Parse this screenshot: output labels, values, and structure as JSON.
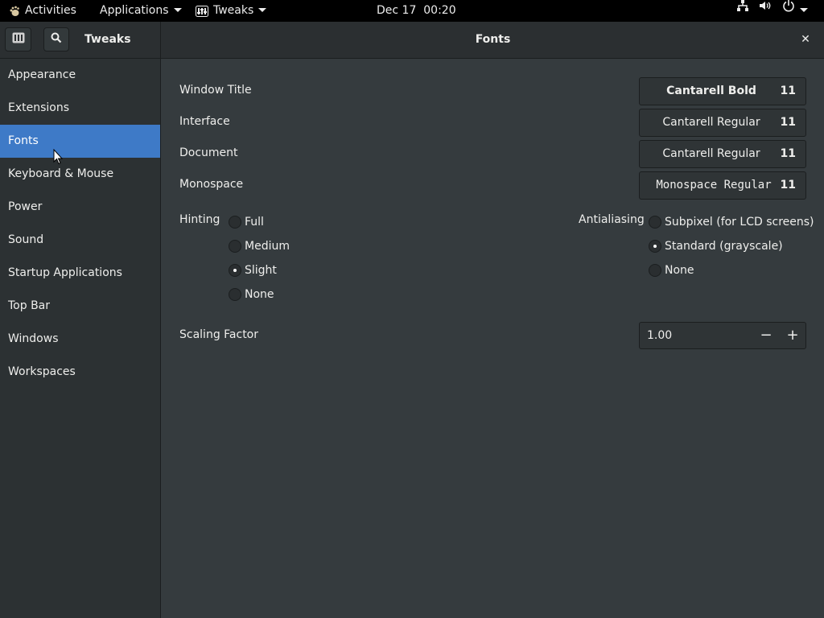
{
  "topbar": {
    "activities": "Activities",
    "applications": "Applications",
    "app_name": "Tweaks",
    "datetime": "Dec 17  00:20"
  },
  "header": {
    "sidebar_title": "Tweaks",
    "page_title": "Fonts",
    "close_glyph": "✕"
  },
  "sidebar": {
    "items": [
      {
        "label": "Appearance"
      },
      {
        "label": "Extensions"
      },
      {
        "label": "Fonts"
      },
      {
        "label": "Keyboard & Mouse"
      },
      {
        "label": "Power"
      },
      {
        "label": "Sound"
      },
      {
        "label": "Startup Applications"
      },
      {
        "label": "Top Bar"
      },
      {
        "label": "Windows"
      },
      {
        "label": "Workspaces"
      }
    ],
    "selected": "Fonts"
  },
  "fonts": {
    "rows": [
      {
        "label": "Window Title",
        "font": "Cantarell Bold",
        "size": "11"
      },
      {
        "label": "Interface",
        "font": "Cantarell Regular",
        "size": "11"
      },
      {
        "label": "Document",
        "font": "Cantarell Regular",
        "size": "11"
      },
      {
        "label": "Monospace",
        "font": "Monospace Regular",
        "size": "11"
      }
    ]
  },
  "hinting": {
    "label": "Hinting",
    "options": [
      "Full",
      "Medium",
      "Slight",
      "None"
    ],
    "selected": "Slight"
  },
  "antialiasing": {
    "label": "Antialiasing",
    "options": [
      "Subpixel (for LCD screens)",
      "Standard (grayscale)",
      "None"
    ],
    "selected": "Standard (grayscale)"
  },
  "scaling": {
    "label": "Scaling Factor",
    "value": "1.00",
    "minus": "−",
    "plus": "+"
  },
  "colors": {
    "accent": "#3e7ac7",
    "background": "#353b3e",
    "sidebar": "#2c3133",
    "headerbar": "#2b2f31"
  }
}
